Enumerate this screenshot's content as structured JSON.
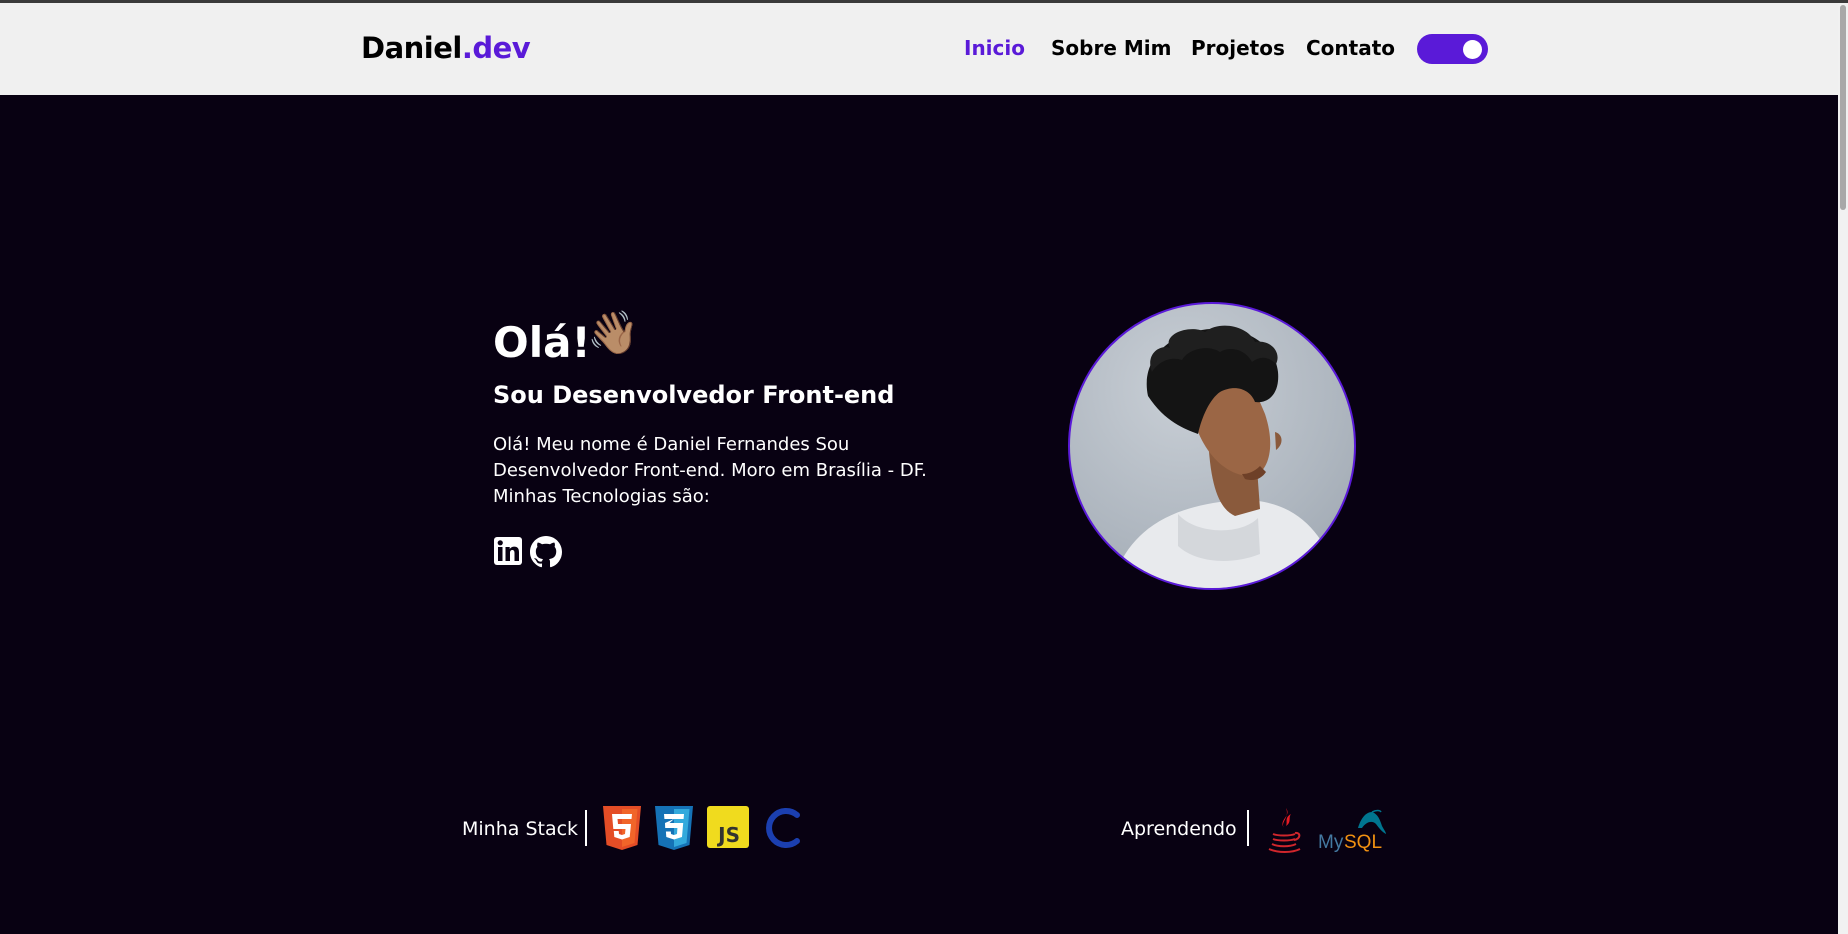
{
  "header": {
    "logo": {
      "main": "Daniel",
      "accent": ".dev"
    },
    "nav": [
      {
        "label": "Inicio",
        "active": true
      },
      {
        "label": "Sobre Mim",
        "active": false
      },
      {
        "label": "Projetos",
        "active": false
      },
      {
        "label": "Contato",
        "active": false
      }
    ],
    "theme_toggle": {
      "state": "on"
    }
  },
  "hero": {
    "greeting": "Olá!",
    "greeting_emoji": "👋🏽",
    "subtitle": "Sou Desenvolvedor Front-end",
    "bio": "Olá! Meu nome é Daniel Fernandes Sou Desenvolvedor Front-end. Moro em Brasília - DF. Minhas Tecnologias são:",
    "socials": [
      "linkedin-icon",
      "github-icon"
    ],
    "photo": "profile-photo"
  },
  "stack": {
    "label": "Minha Stack",
    "items": [
      "html5-icon",
      "css3-icon",
      "javascript-icon",
      "c-icon"
    ],
    "js_badge_text": "JS"
  },
  "learning": {
    "label": "Aprendendo",
    "items": [
      "java-icon",
      "mysql-icon"
    ],
    "mysql_text_my": "My",
    "mysql_text_sql": "SQL"
  },
  "colors": {
    "accent": "#5a1ad8",
    "background": "#080112",
    "header_bg": "#f0f0f0"
  }
}
